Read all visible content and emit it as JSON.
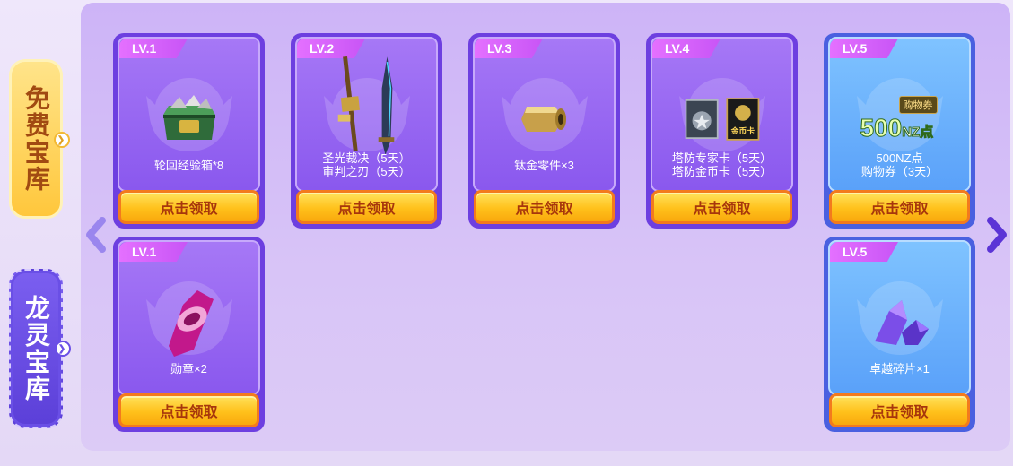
{
  "side_tabs": [
    {
      "label": "免费宝库",
      "active": true
    },
    {
      "label": "龙灵宝库",
      "active": false
    }
  ],
  "nav": {
    "prev_icon": "chevron-left-icon",
    "next_icon": "chevron-right-icon"
  },
  "colors": {
    "panel": "#cdb4f7",
    "card_purple": "#6d3fe0",
    "card_blue": "#4a60e0",
    "button": "#ffc11b",
    "button_text": "#a7360c",
    "badge": "#d660fb"
  },
  "cards": [
    {
      "level": "LV.1",
      "name": "轮回经验箱*8",
      "button": "点击领取",
      "icon": "treasure-chest-icon",
      "theme": "purple"
    },
    {
      "level": "LV.2",
      "name": "圣光裁决（5天）\n审判之刃（5天）",
      "button": "点击领取",
      "icon": "weapons-icon",
      "theme": "purple"
    },
    {
      "level": "LV.3",
      "name": "钛金零件×3",
      "button": "点击领取",
      "icon": "titanium-part-icon",
      "theme": "purple"
    },
    {
      "level": "LV.4",
      "name": "塔防专家卡（5天）\n塔防金币卡（5天）",
      "button": "点击领取",
      "icon": "cards-icon",
      "card2_text": "金币卡",
      "theme": "purple"
    },
    {
      "level": "LV.5",
      "name": "500NZ点\n购物券（3天）",
      "button": "点击领取",
      "icon": "voucher-icon",
      "voucher_tag": "购物券",
      "voucher_value": "500",
      "voucher_unit": "NZ点",
      "theme": "blue"
    },
    {
      "level": "LV.1",
      "name": "勋章×2",
      "button": "点击领取",
      "icon": "medal-icon",
      "theme": "purple"
    },
    {
      "level": "LV.5",
      "name": "卓越碎片×1",
      "button": "点击领取",
      "icon": "crystal-shard-icon",
      "theme": "blue"
    }
  ]
}
